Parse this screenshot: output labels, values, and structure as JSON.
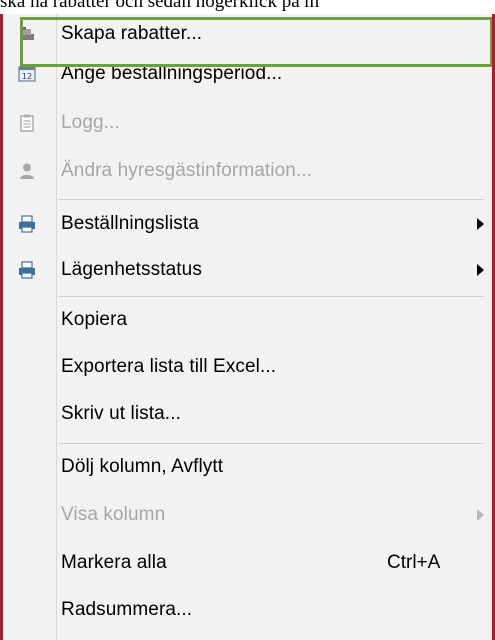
{
  "background_text": "ska ha rabatter och sedan högerklick på m",
  "menu": {
    "items": [
      {
        "label": "Skapa rabatter...",
        "icon": "discount-icon",
        "disabled": false,
        "submenu": false,
        "shortcut": ""
      },
      {
        "label": "Ange beställningsperiod...",
        "icon": "calendar-icon",
        "disabled": false,
        "submenu": false,
        "shortcut": ""
      },
      {
        "label": "Logg...",
        "icon": "log-icon",
        "disabled": true,
        "submenu": false,
        "shortcut": ""
      },
      {
        "label": "Ändra hyresgästinformation...",
        "icon": "user-icon",
        "disabled": true,
        "submenu": false,
        "shortcut": ""
      },
      {
        "label": "Beställningslista",
        "icon": "printer-icon",
        "disabled": false,
        "submenu": true,
        "shortcut": ""
      },
      {
        "label": "Lägenhetsstatus",
        "icon": "printer-icon",
        "disabled": false,
        "submenu": true,
        "shortcut": ""
      },
      {
        "label": "Kopiera",
        "icon": "",
        "disabled": false,
        "submenu": false,
        "shortcut": ""
      },
      {
        "label": "Exportera lista till Excel...",
        "icon": "",
        "disabled": false,
        "submenu": false,
        "shortcut": ""
      },
      {
        "label": "Skriv ut lista...",
        "icon": "",
        "disabled": false,
        "submenu": false,
        "shortcut": ""
      },
      {
        "label": "Dölj kolumn, Avflytt",
        "icon": "",
        "disabled": false,
        "submenu": false,
        "shortcut": ""
      },
      {
        "label": "Visa kolumn",
        "icon": "",
        "disabled": true,
        "submenu": true,
        "shortcut": ""
      },
      {
        "label": "Markera alla",
        "icon": "",
        "disabled": false,
        "submenu": false,
        "shortcut": "Ctrl+A"
      },
      {
        "label": "Radsummera...",
        "icon": "",
        "disabled": false,
        "submenu": false,
        "shortcut": ""
      }
    ]
  },
  "colors": {
    "highlight_border": "#6aa13c",
    "window_border": "#b5172b",
    "disabled_text": "#a6a6a6"
  }
}
